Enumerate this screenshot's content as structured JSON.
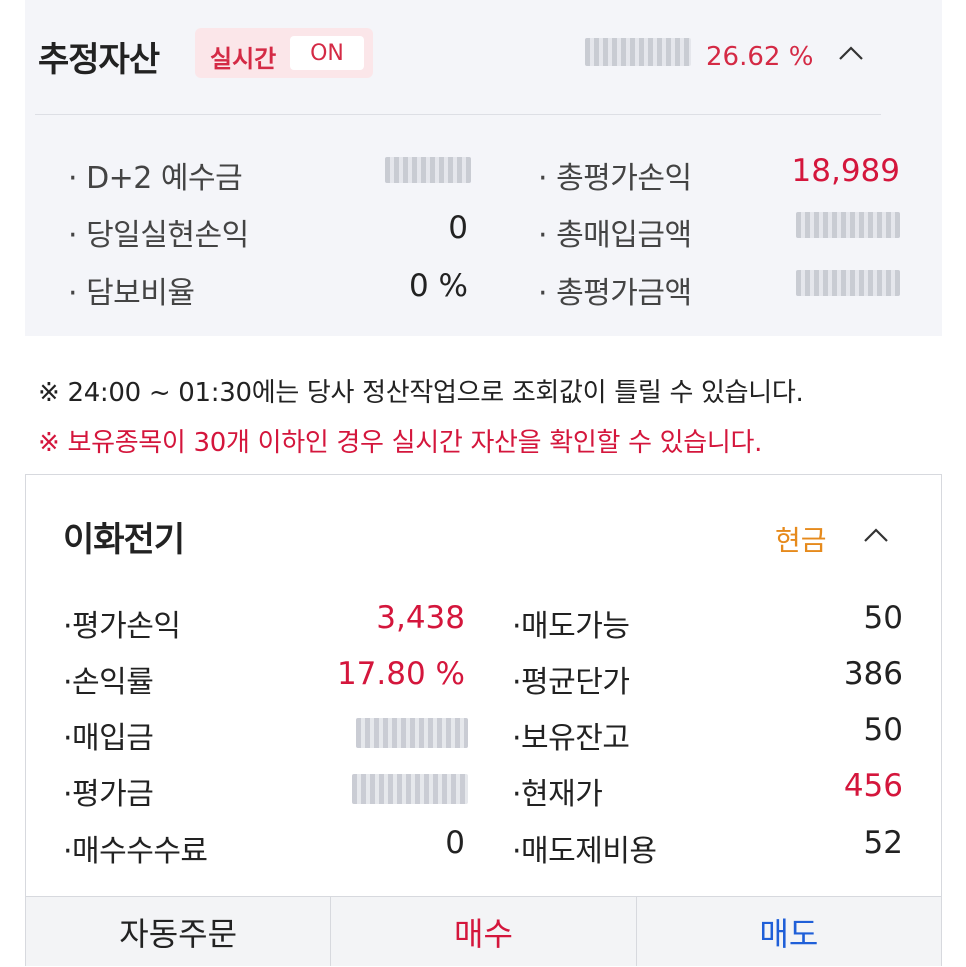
{
  "summary": {
    "title": "추정자산",
    "realtime_label": "실시간",
    "realtime_state": "ON",
    "total_rate": "26.62 %",
    "rows": [
      {
        "label": "· D+2 예수금",
        "value": "",
        "masked": true
      },
      {
        "label": "· 당일실현손익",
        "value": "0",
        "masked": false
      },
      {
        "label": "· 담보비율",
        "value": "0 %",
        "masked": false
      }
    ],
    "rows_right": [
      {
        "label": "· 총평가손익",
        "value": "18,989",
        "masked": false
      },
      {
        "label": "· 총매입금액",
        "value": "",
        "masked": true
      },
      {
        "label": "· 총평가금액",
        "value": "",
        "masked": true
      }
    ]
  },
  "notices": {
    "line1": "※ 24:00 ~ 01:30에는 당사 정산작업으로 조회값이 틀릴 수 있습니다.",
    "line2": "※ 보유종목이 30개 이하인 경우 실시간 자산을 확인할 수 있습니다."
  },
  "holding": {
    "name": "이화전기",
    "type": "현금",
    "left": [
      {
        "label": "·평가손익",
        "value": "3,438"
      },
      {
        "label": "·손익률",
        "value": "17.80 %"
      },
      {
        "label": "·매입금",
        "value": ""
      },
      {
        "label": "·평가금",
        "value": ""
      },
      {
        "label": "·매수수수료",
        "value": "0"
      }
    ],
    "right": [
      {
        "label": "·매도가능",
        "value": "50"
      },
      {
        "label": "·평균단가",
        "value": "386"
      },
      {
        "label": "·보유잔고",
        "value": "50"
      },
      {
        "label": "·현재가",
        "value": "456"
      },
      {
        "label": "·매도제비용",
        "value": "52"
      }
    ]
  },
  "actions": {
    "auto_order": "자동주문",
    "buy": "매수",
    "sell": "매도"
  },
  "colors": {
    "up_red": "#d4163c",
    "sell_blue": "#1f5fd8",
    "cash_orange": "#e68a1c",
    "panel_bg": "#f4f5f9"
  },
  "icons": {
    "collapse": "chevron-up-icon"
  }
}
